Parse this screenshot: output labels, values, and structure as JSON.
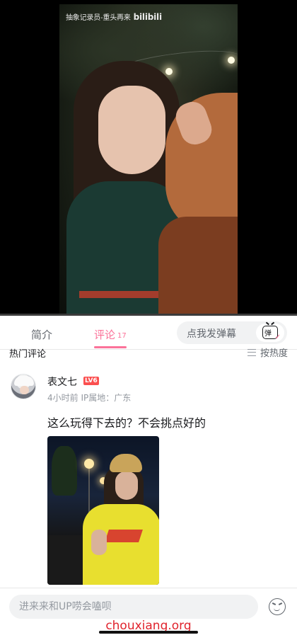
{
  "video": {
    "watermark": "抽象记录员-重头再来",
    "brand": "bilibili",
    "progress": 0
  },
  "tabs": {
    "intro": "简介",
    "comments": "评论",
    "comments_count": "17",
    "danmaku_placeholder": "点我发弹幕",
    "danmaku_icon_glyph": "弹"
  },
  "comments_section": {
    "title": "热门评论",
    "sort_label": "按热度"
  },
  "comments": [
    {
      "username": "表文七",
      "level": "LV6",
      "meta": "4小时前 IP属地：广东",
      "text": "这么玩得下去的？不会挑点好的"
    }
  ],
  "bottom_bar": {
    "input_placeholder": "进来来和UP唠会嗑呗",
    "watermark_site": "chouxiang.org"
  },
  "colors": {
    "accent": "#fb7299",
    "level_badge": "#fb4f4f",
    "site_watermark": "#e0232d"
  }
}
